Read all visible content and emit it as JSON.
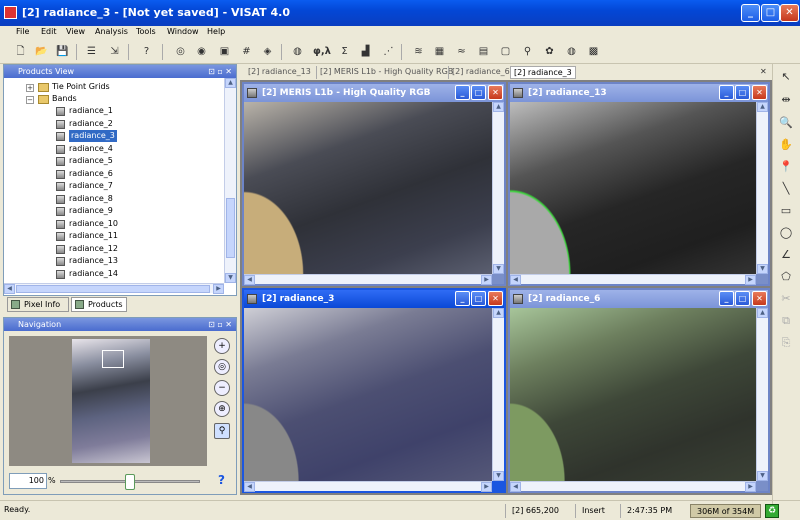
{
  "window": {
    "title": "[2] radiance_3 - [Not yet saved] - VISAT 4.0"
  },
  "menu": [
    "File",
    "Edit",
    "View",
    "Analysis",
    "Tools",
    "Window",
    "Help"
  ],
  "toolbar": {
    "icons": [
      "new-product-icon",
      "open-product-icon",
      "save-product-icon",
      "properties-icon",
      "export-icon",
      "help-icon",
      "image-view-icon",
      "pixel-info-icon",
      "statistics-icon",
      "overlay-icon",
      "layers-icon",
      "band-maths-icon",
      "phi-lambda-icon",
      "sigma-icon",
      "histogram-icon",
      "scatter-plot-icon",
      "projection-icon",
      "mosaic-icon",
      "spectrum-icon",
      "database-icon",
      "roi-icon",
      "pin-icon",
      "palette-icon",
      "globe-icon",
      "grid-icon"
    ],
    "phi_lambda_label": "φ,λ",
    "sigma_label": "Σ",
    "help_label": "?"
  },
  "products_view": {
    "title": "Products View",
    "tree": {
      "tie_point_grids": "Tie Point Grids",
      "bands": "Bands"
    },
    "bands": [
      "radiance_1",
      "radiance_2",
      "radiance_3",
      "radiance_4",
      "radiance_5",
      "radiance_6",
      "radiance_7",
      "radiance_8",
      "radiance_9",
      "radiance_10",
      "radiance_11",
      "radiance_12",
      "radiance_13",
      "radiance_14"
    ],
    "selected": "radiance_3"
  },
  "panel_tabs": [
    "Pixel Info",
    "Products"
  ],
  "navigation": {
    "title": "Navigation",
    "zoom_value": "100",
    "zoom_unit": "%",
    "help": "?",
    "zoom_slider_fraction": 0.5
  },
  "doc_tabs": [
    "[2] radiance_13",
    "[2] MERIS L1b - High Quality RGB",
    "[2] radiance_6",
    "[2] radiance_3"
  ],
  "views": [
    {
      "title": "[2] MERIS L1b - High Quality RGB",
      "active": false
    },
    {
      "title": "[2] radiance_13",
      "active": false
    },
    {
      "title": "[2] radiance_3",
      "active": true
    },
    {
      "title": "[2] radiance_6",
      "active": false
    }
  ],
  "status": {
    "ready": "Ready.",
    "coords": "[2] 665,200",
    "mode": "Insert",
    "time": "2:47:35 PM",
    "memory": "306M of 354M"
  }
}
